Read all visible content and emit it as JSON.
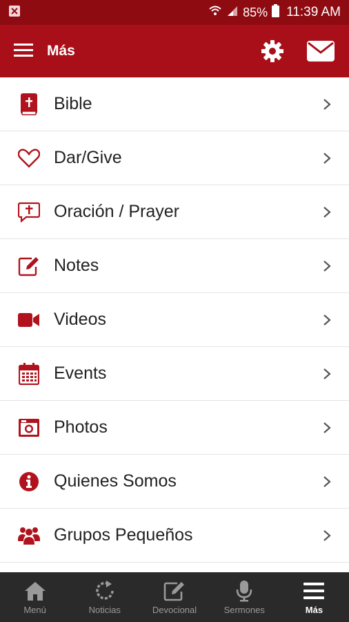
{
  "status_bar": {
    "battery_percent": "85%",
    "time": "11:39 AM"
  },
  "app_bar": {
    "title": "Más",
    "settings_icon": "gear-icon",
    "mail_icon": "mail-icon"
  },
  "menu": {
    "items": [
      {
        "label": "Bible",
        "icon": "bible-icon"
      },
      {
        "label": "Dar/Give",
        "icon": "heart-icon"
      },
      {
        "label": "Oración / Prayer",
        "icon": "prayer-icon"
      },
      {
        "label": "Notes",
        "icon": "notes-icon"
      },
      {
        "label": "Videos",
        "icon": "video-icon"
      },
      {
        "label": "Events",
        "icon": "calendar-icon"
      },
      {
        "label": "Photos",
        "icon": "photo-icon"
      },
      {
        "label": "Quienes Somos",
        "icon": "info-icon"
      },
      {
        "label": "Grupos Pequeños",
        "icon": "group-icon"
      }
    ]
  },
  "bottom_nav": {
    "items": [
      {
        "label": "Menú",
        "icon": "home-icon"
      },
      {
        "label": "Noticias",
        "icon": "refresh-icon"
      },
      {
        "label": "Devocional",
        "icon": "edit-icon"
      },
      {
        "label": "Sermones",
        "icon": "microphone-icon"
      },
      {
        "label": "Más",
        "icon": "menu-icon"
      }
    ],
    "active_index": 4
  },
  "colors": {
    "status_bar": "#8e0b12",
    "app_bar": "#a80f19",
    "accent": "#b0131d",
    "nav_bg": "#2a2a2a"
  }
}
